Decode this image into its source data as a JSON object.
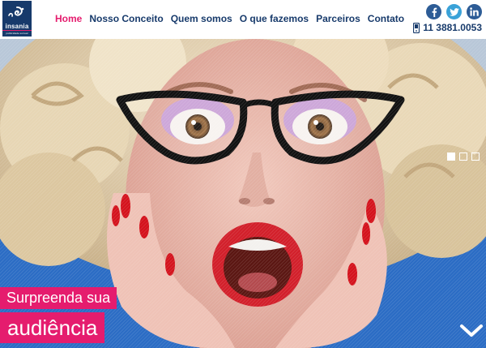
{
  "brand": {
    "name": "insania",
    "tagline": "publicidade surreal"
  },
  "nav": {
    "items": [
      {
        "label": "Home",
        "active": true
      },
      {
        "label": "Nosso Conceito"
      },
      {
        "label": "Quem somos"
      },
      {
        "label": "O que fazemos"
      },
      {
        "label": "Parceiros"
      },
      {
        "label": "Contato"
      }
    ]
  },
  "social": {
    "icons": [
      "facebook-icon",
      "twitter-icon",
      "linkedin-icon"
    ]
  },
  "contact": {
    "phone": "11 3881.0053",
    "icon": "phone-icon"
  },
  "hero": {
    "caption_line1": "Surpreenda sua",
    "caption_line2": "audiência",
    "slides": {
      "count": 3,
      "active": 1
    },
    "scroll_icon": "chevron-down-icon"
  },
  "colors": {
    "accent": "#e51c6e",
    "navy": "#173a6b",
    "facebook": "#2d5c96",
    "twitter": "#3aa2d8"
  }
}
